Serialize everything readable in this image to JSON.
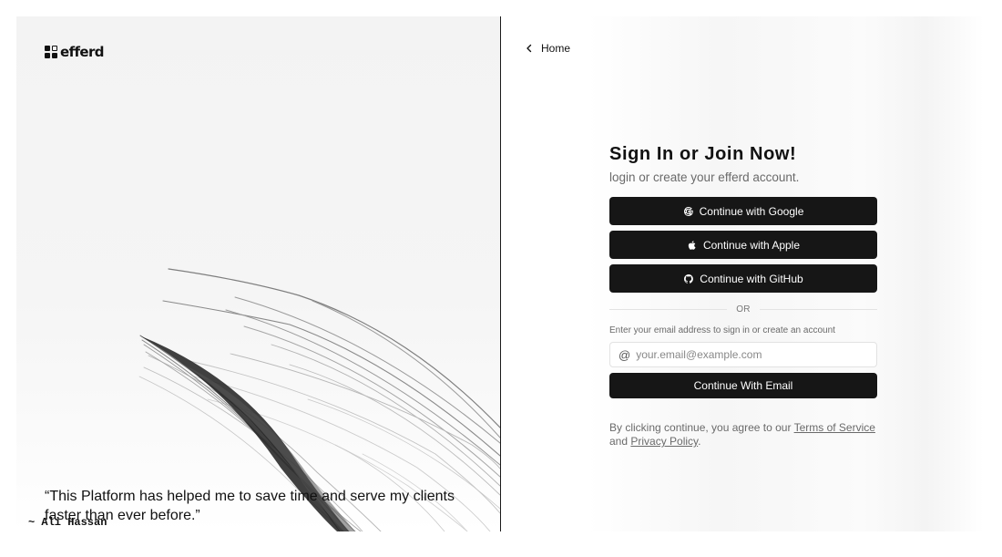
{
  "brand": {
    "name": "efferd",
    "logo_icon": "logo-grid-icon"
  },
  "nav": {
    "home_label": "Home",
    "home_icon": "chevron-left-icon"
  },
  "auth": {
    "title": "Sign In or Join Now!",
    "subtitle": "login or create your efferd account.",
    "providers": [
      {
        "label": "Continue with Google",
        "icon": "google-icon"
      },
      {
        "label": "Continue with Apple",
        "icon": "apple-icon"
      },
      {
        "label": "Continue with GitHub",
        "icon": "github-icon"
      }
    ],
    "divider_text": "OR",
    "email_hint": "Enter your email address to sign in or create an account",
    "email_placeholder": "your.email@example.com",
    "email_icon": "at-sign-icon",
    "email_button": "Continue With Email",
    "legal": {
      "prefix": "By clicking continue, you agree to our ",
      "terms": "Terms of Service",
      "middle": " and ",
      "privacy": "Privacy Policy",
      "suffix": "."
    }
  },
  "testimonial": {
    "quote": "“This Platform has helped me to save time and serve my clients faster than ever before.”",
    "author": "~ Ali Hassan"
  },
  "colors": {
    "button_bg": "#161616",
    "button_text": "#ffffff",
    "divider": "#1a1a1a",
    "muted_text": "#6a6a6a"
  }
}
